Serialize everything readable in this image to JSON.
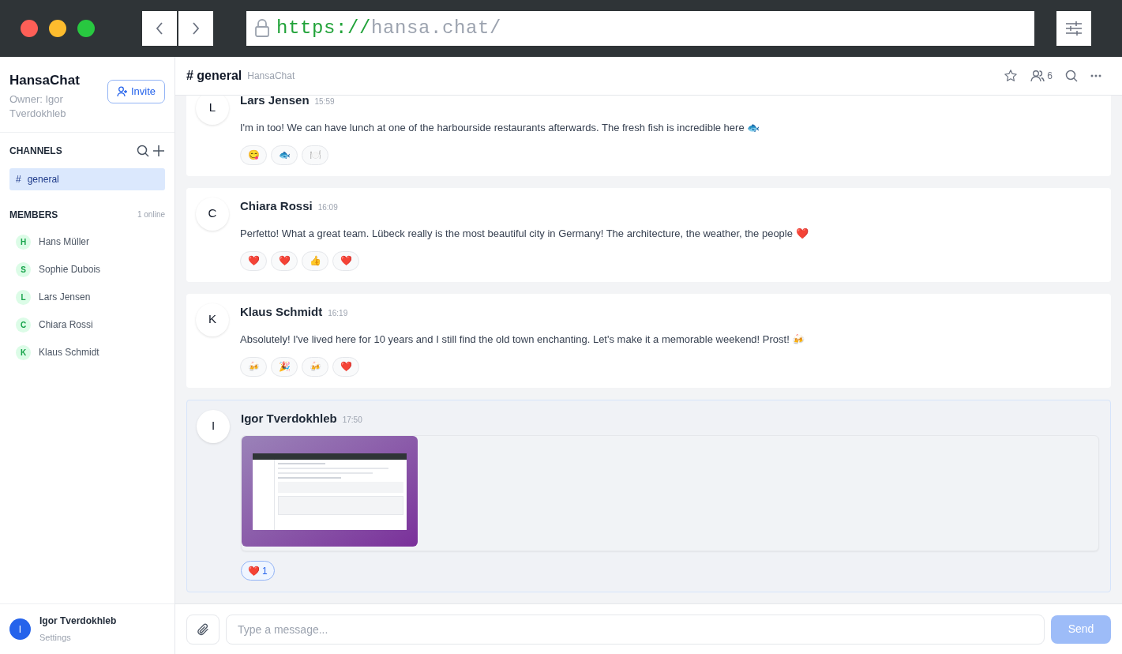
{
  "browser": {
    "url_scheme": "https://",
    "url_host": "hansa.chat/"
  },
  "sidebar": {
    "title": "HansaChat",
    "owner": "Owner: Igor Tverdokhleb",
    "invite_button": "Invite",
    "channels_heading": "CHANNELS",
    "channels": [
      {
        "hash": "#",
        "name": "general",
        "selected": true
      }
    ],
    "members_heading": "MEMBERS",
    "online_count": "1 online",
    "members": [
      {
        "initial": "H",
        "name": "Hans Müller"
      },
      {
        "initial": "S",
        "name": "Sophie Dubois"
      },
      {
        "initial": "L",
        "name": "Lars Jensen"
      },
      {
        "initial": "C",
        "name": "Chiara Rossi"
      },
      {
        "initial": "K",
        "name": "Klaus Schmidt"
      }
    ],
    "user": {
      "initial": "I",
      "name": "Igor Tverdokhleb",
      "link": "Settings"
    }
  },
  "header": {
    "channel": "# general",
    "workspace": "HansaChat",
    "member_count": "6"
  },
  "messages": [
    {
      "initial": "L",
      "author": "Lars Jensen",
      "time": "15:59",
      "highlighted": false,
      "text": "I'm in too! We can have lunch at one of the harbourside restaurants afterwards. The fresh fish is incredible here 🐟",
      "reactions": [
        {
          "emoji": "😋",
          "selected": false
        },
        {
          "emoji": "🐟",
          "selected": false
        },
        {
          "emoji": "🍽️",
          "selected": false
        }
      ]
    },
    {
      "initial": "C",
      "author": "Chiara Rossi",
      "time": "16:09",
      "highlighted": false,
      "text": "Perfetto! What a great team. Lübeck really is the most beautiful city in Germany! The architecture, the weather, the people ❤️",
      "reactions": [
        {
          "emoji": "❤️",
          "selected": false
        },
        {
          "emoji": "❤️",
          "selected": false
        },
        {
          "emoji": "👍",
          "selected": false
        },
        {
          "emoji": "❤️",
          "selected": false
        }
      ]
    },
    {
      "initial": "K",
      "author": "Klaus Schmidt",
      "time": "16:19",
      "highlighted": false,
      "text": "Absolutely! I've lived here for 10 years and I still find the old town enchanting. Let's make it a memorable weekend! Prost! 🍻",
      "reactions": [
        {
          "emoji": "🍻",
          "selected": false
        },
        {
          "emoji": "🎉",
          "selected": false
        },
        {
          "emoji": "🍻",
          "selected": false
        },
        {
          "emoji": "❤️",
          "selected": false
        }
      ]
    },
    {
      "initial": "I",
      "author": "Igor Tverdokhleb",
      "time": "17:50",
      "highlighted": true,
      "attachment": true,
      "reactions": [
        {
          "emoji": "❤️",
          "count": "1",
          "selected": true
        }
      ]
    }
  ],
  "composer": {
    "placeholder": "Type a message...",
    "send_button": "Send",
    "send_disabled": true
  }
}
